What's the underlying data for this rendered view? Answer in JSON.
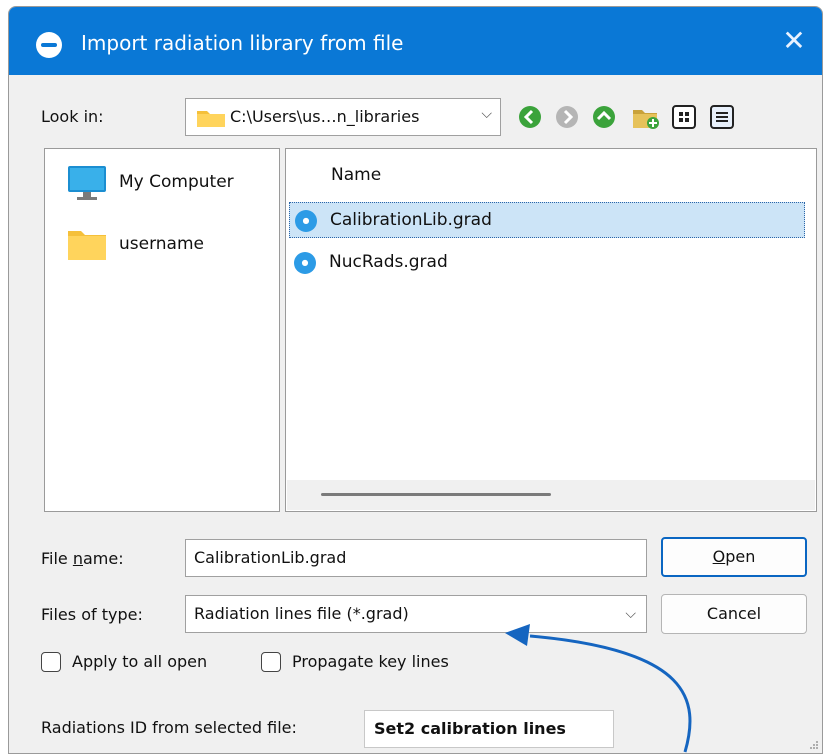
{
  "window": {
    "title": "Import radiation library from file",
    "close_glyph": "✕",
    "icon": "app-logo-icon"
  },
  "look_in": {
    "label": "Look in:",
    "path": "C:\\Users\\us…n_libraries",
    "chevron": "⌵"
  },
  "toolbar": {
    "buttons": [
      "back-icon",
      "forward-icon",
      "up-folder-icon",
      "new-folder-icon",
      "list-view-icon",
      "detail-view-icon"
    ]
  },
  "places": [
    {
      "label": "My Computer",
      "icon": "computer-icon"
    },
    {
      "label": "username",
      "icon": "folder-icon"
    }
  ],
  "file_list": {
    "column_name": "Name",
    "files": [
      {
        "name": "CalibrationLib.grad",
        "selected": true
      },
      {
        "name": "NucRads.grad",
        "selected": false
      }
    ]
  },
  "file_name": {
    "label_prefix": "File ",
    "label_accel": "n",
    "label_suffix": "ame:",
    "value": "CalibrationLib.grad"
  },
  "file_type": {
    "label": "Files of type:",
    "value": "Radiation lines file (*.grad)",
    "chevron": "⌵"
  },
  "buttons": {
    "open_accel": "O",
    "open_rest": "pen",
    "cancel": "Cancel"
  },
  "options": {
    "apply_all": "Apply to all open",
    "propagate": "Propagate key lines"
  },
  "radiations_id": {
    "label": "Radiations ID from selected file:",
    "value": "Set2 calibration lines"
  },
  "colors": {
    "titlebar": "#0a78d6",
    "selection": "#cce4f7",
    "annotation_arrow": "#1565c0"
  }
}
